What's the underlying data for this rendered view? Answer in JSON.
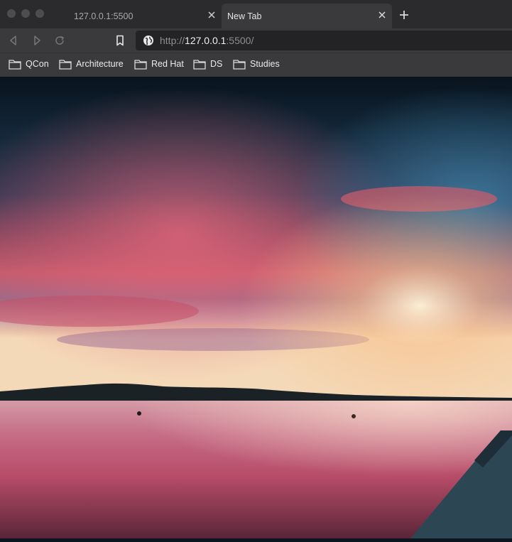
{
  "tabs": [
    {
      "title": "127.0.0.1:5500",
      "active": false
    },
    {
      "title": "New Tab",
      "active": true
    }
  ],
  "toolbar": {
    "url_scheme": "http://",
    "url_host": "127.0.0.1",
    "url_rest": ":5500/"
  },
  "bookmarks": [
    {
      "label": "QCon"
    },
    {
      "label": "Architecture"
    },
    {
      "label": "Red Hat"
    },
    {
      "label": "DS"
    },
    {
      "label": "Studies"
    }
  ],
  "colors": {
    "chrome": "#3a3a3c",
    "tabstrip": "#2b2b2d",
    "urlbar": "#232325"
  },
  "icons": {
    "back": "back-arrow-icon",
    "forward": "forward-arrow-icon",
    "reload": "reload-icon",
    "bookmark": "bookmark-icon",
    "site": "globe-icon",
    "folder": "folder-icon",
    "close": "close-icon",
    "new_tab": "plus-icon"
  }
}
